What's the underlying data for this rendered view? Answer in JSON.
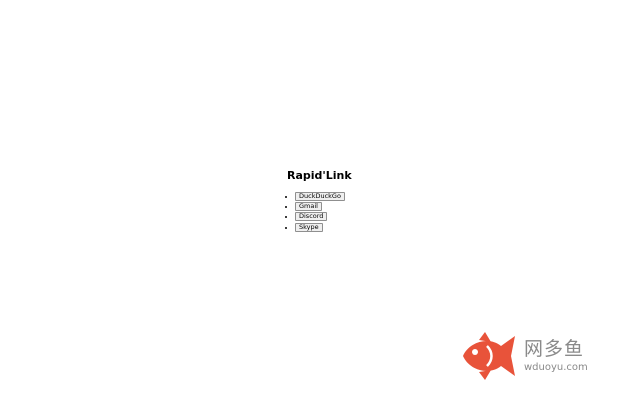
{
  "app": {
    "title": "Rapid'Link"
  },
  "links": [
    {
      "label": "DuckDuckGo"
    },
    {
      "label": "Gmail"
    },
    {
      "label": "Discord"
    },
    {
      "label": "Skype"
    }
  ],
  "watermark": {
    "name": "网多鱼",
    "url": "wduoyu.com",
    "icon": "fish-logo-icon",
    "color": "#e8533a"
  }
}
